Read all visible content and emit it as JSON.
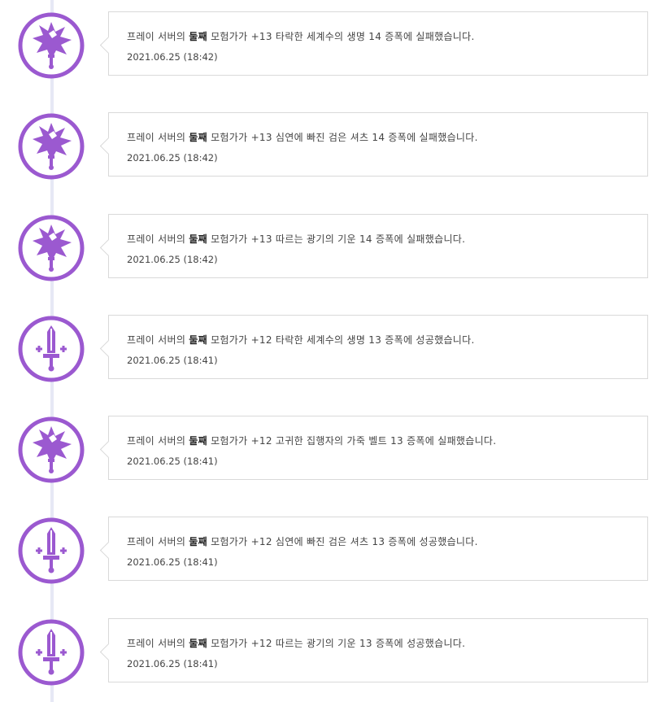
{
  "colors": {
    "accent": "#9b59d0",
    "line": "#e6e8f5",
    "border": "#d9d9d9"
  },
  "entries": [
    {
      "icon": "fail-burst-sword-icon",
      "prefix": "프레이 서버의",
      "name": "둘째",
      "rest": "모험가가 +13 타락한 세계수의 생명 14 증폭에 실패했습니다.",
      "date": "2021.06.25 (18:42)"
    },
    {
      "icon": "fail-burst-sword-icon",
      "prefix": "프레이 서버의",
      "name": "둘째",
      "rest": "모험가가 +13 심연에 빠진 검은 셔츠 14 증폭에 실패했습니다.",
      "date": "2021.06.25 (18:42)"
    },
    {
      "icon": "fail-burst-sword-icon",
      "prefix": "프레이 서버의",
      "name": "둘째",
      "rest": "모험가가 +13 따르는 광기의 기운 14 증폭에 실패했습니다.",
      "date": "2021.06.25 (18:42)"
    },
    {
      "icon": "success-sword-icon",
      "prefix": "프레이 서버의",
      "name": "둘째",
      "rest": "모험가가 +12 타락한 세계수의 생명 13 증폭에 성공했습니다.",
      "date": "2021.06.25 (18:41)"
    },
    {
      "icon": "fail-burst-sword-icon",
      "prefix": "프레이 서버의",
      "name": "둘째",
      "rest": "모험가가 +12 고귀한 집행자의 가죽 벨트 13 증폭에 실패했습니다.",
      "date": "2021.06.25 (18:41)"
    },
    {
      "icon": "success-sword-icon",
      "prefix": "프레이 서버의",
      "name": "둘째",
      "rest": "모험가가 +12 심연에 빠진 검은 셔츠 13 증폭에 성공했습니다.",
      "date": "2021.06.25 (18:41)"
    },
    {
      "icon": "success-sword-icon",
      "prefix": "프레이 서버의",
      "name": "둘째",
      "rest": "모험가가 +12 따르는 광기의 기운 13 증폭에 성공했습니다.",
      "date": "2021.06.25 (18:41)"
    }
  ]
}
